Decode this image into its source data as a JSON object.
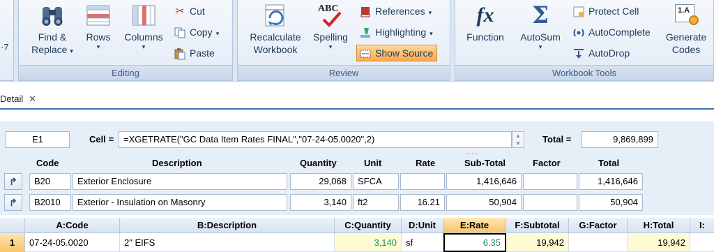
{
  "ribbon": {
    "editing": {
      "label": "Editing",
      "find_replace": {
        "line1": "Find &",
        "line2": "Replace"
      },
      "rows": "Rows",
      "columns": "Columns",
      "cut": "Cut",
      "copy": "Copy",
      "paste": "Paste"
    },
    "review": {
      "label": "Review",
      "recalculate": {
        "line1": "Recalculate",
        "line2": "Workbook"
      },
      "spelling": "Spelling",
      "spelling_icon_text": "ABC",
      "references": "References",
      "highlighting": "Highlighting",
      "show_source": "Show Source"
    },
    "workbook_tools": {
      "label": "Workbook Tools",
      "function": "Function",
      "function_icon_text": "fx",
      "autosum": "AutoSum",
      "autosum_icon_text": "Σ",
      "protect_cell": "Protect Cell",
      "autocomplete": "AutoComplete",
      "autodrop": "AutoDrop",
      "generate_codes": {
        "line1": "Generate",
        "line2": "Codes"
      },
      "generate_icon_text": "1.A"
    },
    "left_fragment": "·7"
  },
  "tab": {
    "label": "Detail",
    "close": "✕"
  },
  "formula_bar": {
    "cell_ref": "E1",
    "cell_label": "Cell =",
    "formula": "=XGETRATE(\"GC Data Item Rates FINAL\",\"07-24-05.0020\",2)",
    "total_label": "Total =",
    "total_value": "9,869,899",
    "grip": "·····"
  },
  "detail": {
    "headers": {
      "code": "Code",
      "description": "Description",
      "quantity": "Quantity",
      "unit": "Unit",
      "rate": "Rate",
      "subtotal": "Sub-Total",
      "factor": "Factor",
      "total": "Total"
    },
    "rows": [
      {
        "arrow": "↱",
        "code": "B20",
        "description": "Exterior Enclosure",
        "quantity": "29,068",
        "unit": "SFCA",
        "rate": "",
        "subtotal": "1,416,646",
        "factor": "",
        "total": "1,416,646"
      },
      {
        "arrow": "↱",
        "code": "B2010",
        "description": "Exterior - Insulation on Masonry",
        "quantity": "3,140",
        "unit": "ft2",
        "rate": "16.21",
        "subtotal": "50,904",
        "factor": "",
        "total": "50,904"
      }
    ]
  },
  "grid": {
    "columns": [
      "A:Code",
      "B:Description",
      "C:Quantity",
      "D:Unit",
      "E:Rate",
      "F:Subtotal",
      "G:Factor",
      "H:Total",
      "I:"
    ],
    "rows": [
      {
        "num": "1",
        "code": "07-24-05.0020",
        "description": "2\" EIFS",
        "quantity": "3,140",
        "unit": "sf",
        "rate": "6.35",
        "subtotal": "19,942",
        "factor": "",
        "total": "19,942"
      }
    ]
  },
  "colors": {
    "accent": "#3c6fb6",
    "selection": "#f9c469",
    "rate_text": "#1f8f5a",
    "highlight_cell": "#fdfbd5"
  }
}
